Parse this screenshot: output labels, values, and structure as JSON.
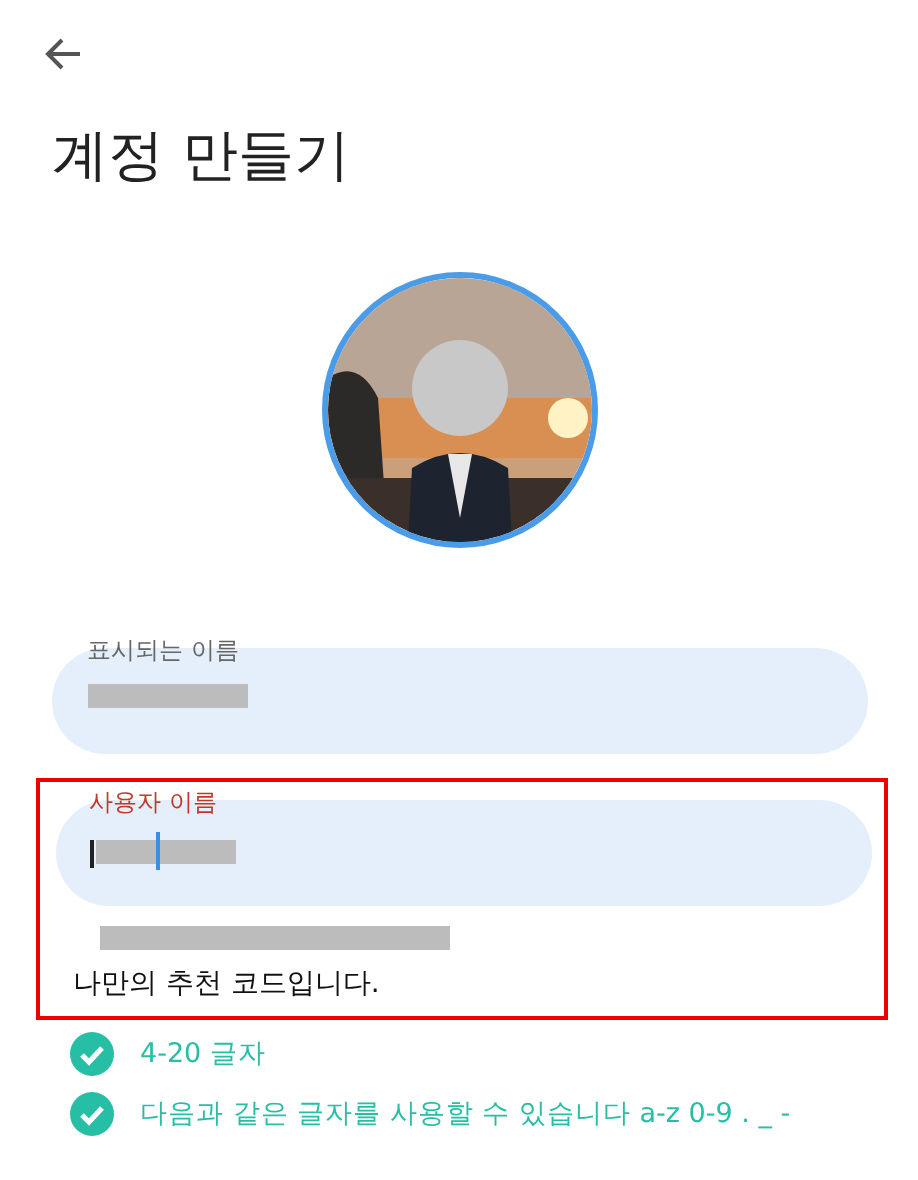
{
  "header": {
    "title": "계정 만들기"
  },
  "fields": [
    {
      "label": "표시되는 이름",
      "error": false,
      "focused": false,
      "redacted": true
    },
    {
      "label": "사용자 이름",
      "error": true,
      "focused": true,
      "redacted": true
    }
  ],
  "hint": "나만의 추천 코드입니다.",
  "requirements": [
    {
      "text": "4-20 글자",
      "checked": true
    },
    {
      "text": "다음과 같은 글자를 사용할 수 있습니다 a-z 0-9 . _ -",
      "checked": true
    }
  ]
}
